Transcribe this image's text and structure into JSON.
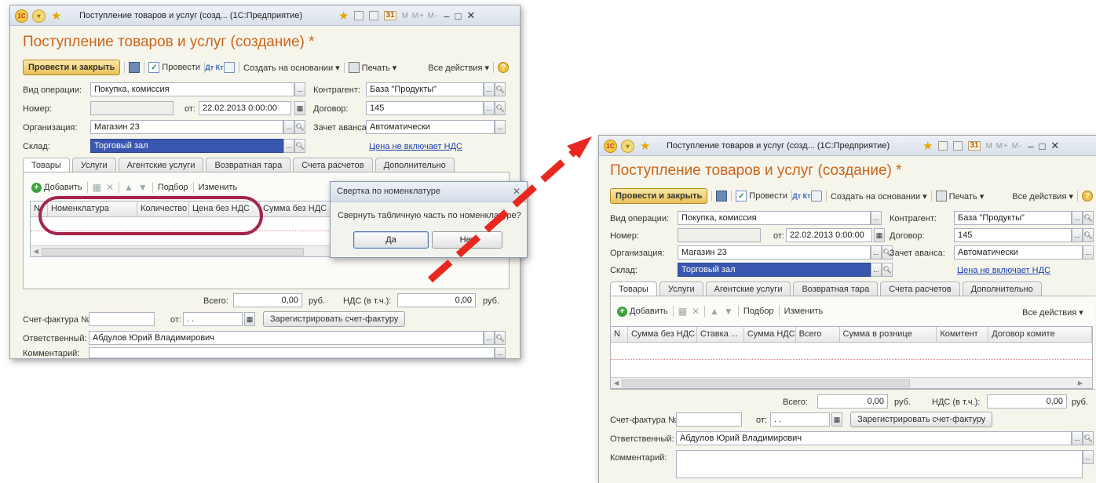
{
  "window": {
    "title_text": "Поступление товаров и услуг (созд... (1С:Предприятие)",
    "form_title": "Поступление товаров и услуг (создание) *",
    "title_icons": [
      "1c-logo-icon",
      "menu-circle-icon",
      "favorite-star-icon",
      "favorite-star-icon",
      "document-icon",
      "calculator-icon",
      "calendar-icon",
      "memory-icon",
      "minimize-icon",
      "restore-icon",
      "close-icon"
    ],
    "calendar_glyph": "31",
    "memory_labels": "M  M+  M-",
    "controls": {
      "minimize": "–",
      "restore": "□",
      "close": "✕"
    }
  },
  "toolbar": {
    "post_close": "Провести и закрыть",
    "post": "Провести",
    "dtkt": "Дт Кт",
    "create_based": "Создать на основании ▾",
    "print": "Печать ▾",
    "all_actions": "Все действия ▾",
    "help": "?"
  },
  "fields": {
    "op_type_label": "Вид операции:",
    "op_type_value": "Покупка, комиссия",
    "number_label": "Номер:",
    "number_value": "",
    "from_label": "от:",
    "date_value": "22.02.2013  0:00:00",
    "org_label": "Организация:",
    "org_value": "Магазин 23",
    "warehouse_label": "Склад:",
    "warehouse_value": "Торговый зал",
    "contractor_label": "Контрагент:",
    "contractor_value": "База \"Продукты\"",
    "contract_label": "Договор:",
    "contract_value": "145",
    "advance_label": "Зачет аванса:",
    "advance_value": "Автоматически",
    "vat_link": "Цена не включает НДС",
    "total_label": "Всего:",
    "total_value": "0,00",
    "currency": "руб.",
    "vat_label": "НДС (в т.ч.):",
    "vat_value": "0,00",
    "invoice_label": "Счет-фактура №:",
    "invoice_value": "",
    "invoice_from": "от:",
    "invoice_date": " .  .",
    "register_invoice": "Зарегистрировать счет-фактуру",
    "responsible_label": "Ответственный:",
    "responsible_value": "Абдулов Юрий Владимирович",
    "comment_label": "Комментарий:",
    "comment_value": ""
  },
  "tabs": [
    "Товары",
    "Услуги",
    "Агентские услуги",
    "Возвратная тара",
    "Счета расчетов",
    "Дополнительно"
  ],
  "table_toolbar": {
    "add": "Добавить",
    "selection": "Подбор",
    "change": "Изменить",
    "all_actions": "Все действия ▾"
  },
  "left_table": {
    "columns": [
      "N",
      "Номенклатура",
      "Количество",
      "Цена без НДС",
      "Сумма без НДС"
    ]
  },
  "right_table": {
    "columns": [
      "N",
      "Сумма без НДС",
      "Ставка ...",
      "Сумма НДС",
      "Всего",
      "Сумма в рознице",
      "Комитент",
      "Договор комите"
    ]
  },
  "dialog": {
    "title": "Свертка по номенклатуре",
    "message": "Свернуть табличную часть по номенклатуре?",
    "yes": "Да",
    "no": "Нет",
    "close": "✕"
  },
  "annotation": {
    "arrow_color": "#e8281f",
    "highlight_color": "#a3264a"
  },
  "colors": {
    "title_orange": "#c9651a",
    "primary_button": "#e8c15a",
    "selected_field": "#3a57b0",
    "link": "#1a3fb0"
  }
}
